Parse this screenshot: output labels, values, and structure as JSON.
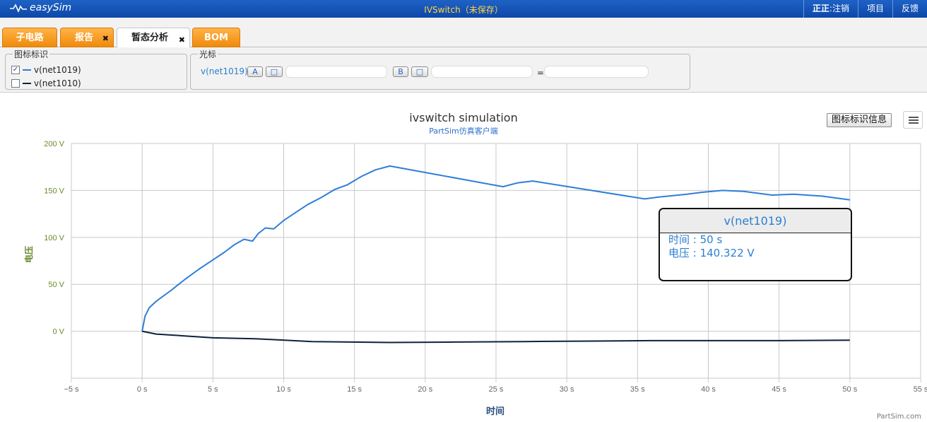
{
  "app": {
    "logo": "easySim",
    "document_title": "IVSwitch（未保存）"
  },
  "top_menu": {
    "user": "正正",
    "logout": ":注销",
    "project": "项目",
    "feedback": "反馈"
  },
  "tabs": [
    {
      "label": "子电路"
    },
    {
      "label": "报告"
    },
    {
      "label": "暂态分析"
    },
    {
      "label": "BOM"
    }
  ],
  "close_glyph": "✖",
  "legend_panel": {
    "title": "图标标识",
    "items": [
      {
        "label": "v(net1019)",
        "checked": true,
        "color": "#2f7ed8"
      },
      {
        "label": "v(net1010)",
        "checked": false,
        "color": "#0d233a"
      }
    ]
  },
  "cursor_panel": {
    "title": "光标",
    "signal": "v(net1019)",
    "button_a": "A",
    "button_b": "B",
    "button_square": "□",
    "equals": "=",
    "field_a_value": "",
    "field_b_value": "",
    "result_value": ""
  },
  "chart_header": {
    "legend_info_button": "图标标识信息",
    "menu_icon": "hamburger-menu-icon"
  },
  "chart_data": {
    "type": "line",
    "title": "ivswitch simulation",
    "subtitle": "PartSim仿真客户端",
    "xlabel": "时间",
    "ylabel": "电压",
    "xlim": [
      -5,
      55
    ],
    "ylim": [
      -50,
      200
    ],
    "x_ticks": [
      "−5 s",
      "0 s",
      "5 s",
      "10 s",
      "15 s",
      "20 s",
      "25 s",
      "30 s",
      "35 s",
      "40 s",
      "45 s",
      "50 s",
      "55 s"
    ],
    "y_ticks": [
      "200 V",
      "150 V",
      "100 V",
      "50 V",
      "0 V"
    ],
    "grid": true,
    "credit": "PartSim.com",
    "series": [
      {
        "name": "v(net1019)",
        "color": "#2f7ed8",
        "points": [
          [
            0,
            0
          ],
          [
            0.2,
            16
          ],
          [
            0.5,
            25
          ],
          [
            1,
            32
          ],
          [
            2,
            43
          ],
          [
            3,
            55
          ],
          [
            4,
            66
          ],
          [
            5,
            76
          ],
          [
            5.8,
            84
          ],
          [
            6.5,
            92
          ],
          [
            7.2,
            98
          ],
          [
            7.8,
            96
          ],
          [
            8.2,
            104
          ],
          [
            8.7,
            110
          ],
          [
            9.3,
            109
          ],
          [
            10,
            118
          ],
          [
            11,
            128
          ],
          [
            11.7,
            135
          ],
          [
            12.6,
            142
          ],
          [
            13.6,
            151
          ],
          [
            14.5,
            156
          ],
          [
            15.5,
            165
          ],
          [
            16.5,
            172
          ],
          [
            17.5,
            176
          ],
          [
            25.5,
            154
          ],
          [
            26.5,
            158
          ],
          [
            27.6,
            160
          ],
          [
            35.5,
            141
          ],
          [
            36.5,
            143
          ],
          [
            38.5,
            146
          ],
          [
            39.5,
            148
          ],
          [
            41,
            150
          ],
          [
            42.5,
            149
          ],
          [
            44.5,
            145
          ],
          [
            46,
            146
          ],
          [
            48,
            144
          ],
          [
            50,
            140
          ]
        ]
      },
      {
        "name": "v(net1010)",
        "color": "#0d233a",
        "points": [
          [
            0,
            0
          ],
          [
            1,
            -3
          ],
          [
            3,
            -5
          ],
          [
            5,
            -7
          ],
          [
            8,
            -8
          ],
          [
            12,
            -11
          ],
          [
            17.5,
            -12
          ],
          [
            22,
            -11.5
          ],
          [
            27,
            -11
          ],
          [
            32,
            -10.5
          ],
          [
            36,
            -10
          ],
          [
            40,
            -10
          ],
          [
            45,
            -10
          ],
          [
            50,
            -9.5
          ]
        ]
      }
    ]
  },
  "tooltip": {
    "title": "v(net1019)",
    "time_label": "时间 : ",
    "time_value": "50 s",
    "voltage_label": "电压 : ",
    "voltage_value": "140.322 V"
  }
}
